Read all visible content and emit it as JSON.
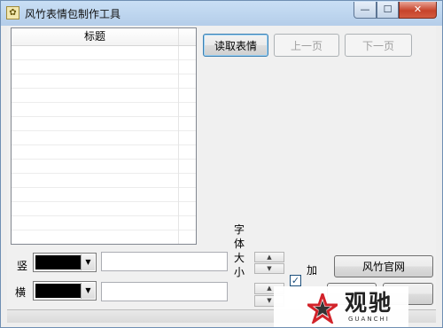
{
  "window": {
    "title": "风竹表情包制作工具",
    "app_icon_glyph": "✿",
    "controls": {
      "minimize": "—",
      "maximize": "☐",
      "close": "✕"
    }
  },
  "list": {
    "columns": [
      "标题"
    ],
    "rows": []
  },
  "toolbar": {
    "read_label": "读取表情",
    "prev_label": "上一页",
    "next_label": "下一页"
  },
  "vertical_row": {
    "label": "竖",
    "color_value": "#000000",
    "text_value": ""
  },
  "horizontal_row": {
    "label": "横",
    "color_value": "#000000",
    "text_value": ""
  },
  "font_size": {
    "chars": [
      "字",
      "体",
      "大",
      "小"
    ],
    "up_arrow": "▲",
    "down_arrow": "▼"
  },
  "bold": {
    "label": "加",
    "checked": true,
    "check_glyph": "✓"
  },
  "website_button_label": "风竹官网",
  "dropdown_arrow": "▼",
  "watermark": {
    "main": "观驰",
    "sub": "GUANCHI"
  },
  "colors": {
    "title_bar": "#c9dff5",
    "close_button": "#c7432b",
    "window_bg": "#f0f0f0",
    "watermark_star_red": "#d2232a"
  }
}
